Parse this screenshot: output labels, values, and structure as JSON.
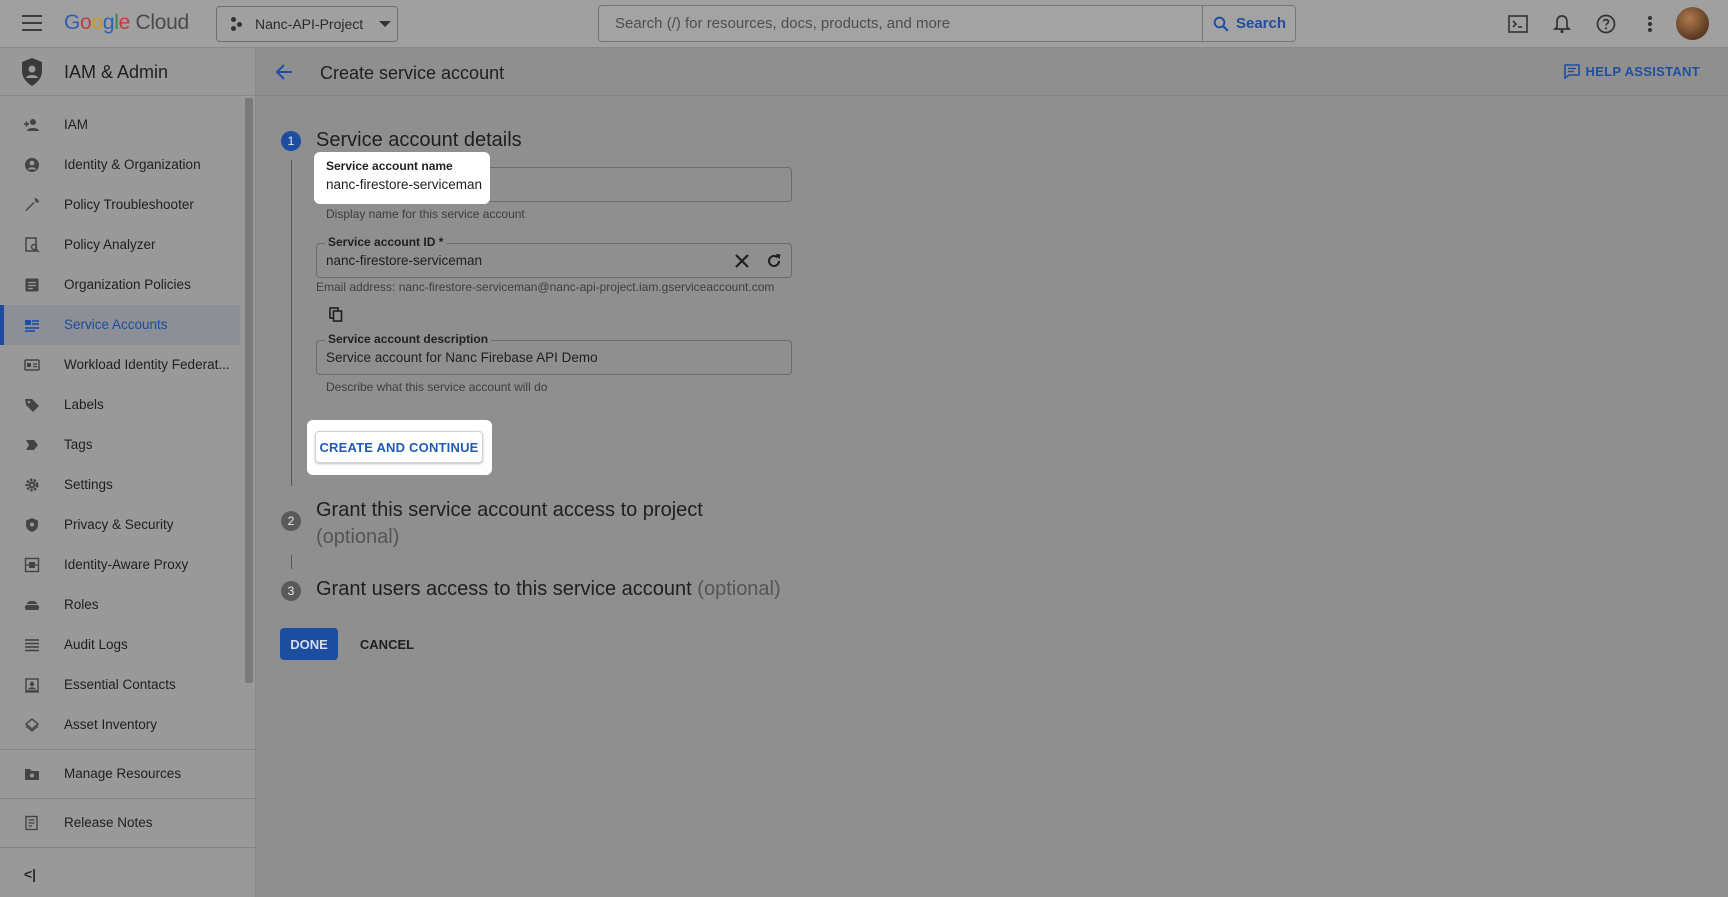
{
  "topbar": {
    "logo_letters": [
      "G",
      "o",
      "o",
      "g",
      "l",
      "e"
    ],
    "logo_suffix": "Cloud",
    "project_name": "Nanc-API-Project",
    "search_placeholder": "Search (/) for resources, docs, products, and more",
    "search_button": "Search"
  },
  "sidebar": {
    "title": "IAM & Admin",
    "items": [
      {
        "label": "IAM",
        "icon": "person-add-icon"
      },
      {
        "label": "Identity & Organization",
        "icon": "account-circle-icon"
      },
      {
        "label": "Policy Troubleshooter",
        "icon": "wrench-icon"
      },
      {
        "label": "Policy Analyzer",
        "icon": "document-search-icon"
      },
      {
        "label": "Organization Policies",
        "icon": "list-document-icon"
      },
      {
        "label": "Service Accounts",
        "icon": "service-account-icon",
        "active": true
      },
      {
        "label": "Workload Identity Federat...",
        "icon": "id-card-icon"
      },
      {
        "label": "Labels",
        "icon": "label-icon"
      },
      {
        "label": "Tags",
        "icon": "tag-icon"
      },
      {
        "label": "Settings",
        "icon": "gear-icon"
      },
      {
        "label": "Privacy & Security",
        "icon": "shield-icon"
      },
      {
        "label": "Identity-Aware Proxy",
        "icon": "proxy-icon"
      },
      {
        "label": "Roles",
        "icon": "roles-icon"
      },
      {
        "label": "Audit Logs",
        "icon": "list-icon"
      },
      {
        "label": "Essential Contacts",
        "icon": "contacts-icon"
      },
      {
        "label": "Asset Inventory",
        "icon": "diamond-stack-icon"
      }
    ],
    "manage_resources": "Manage Resources",
    "release_notes": "Release Notes",
    "collapse": "<|"
  },
  "main": {
    "title": "Create service account",
    "help_assistant": "HELP ASSISTANT",
    "step1": {
      "number": "1",
      "title": "Service account details",
      "name_label": "Service account name",
      "name_value": "nanc-firestore-serviceman",
      "name_hint": "Display name for this service account",
      "id_label": "Service account ID *",
      "id_value": "nanc-firestore-serviceman",
      "email_hint": "Email address: nanc-firestore-serviceman@nanc-api-project.iam.gserviceaccount.com",
      "desc_label": "Service account description",
      "desc_value": "Service account for Nanc Firebase API Demo",
      "desc_hint": "Describe what this service account will do",
      "create_button": "CREATE AND CONTINUE"
    },
    "step2": {
      "number": "2",
      "title": "Grant this service account access to project",
      "optional": "(optional)"
    },
    "step3": {
      "number": "3",
      "title": "Grant users access to this service account",
      "optional": "(optional)"
    },
    "done_button": "DONE",
    "cancel_button": "CANCEL"
  }
}
